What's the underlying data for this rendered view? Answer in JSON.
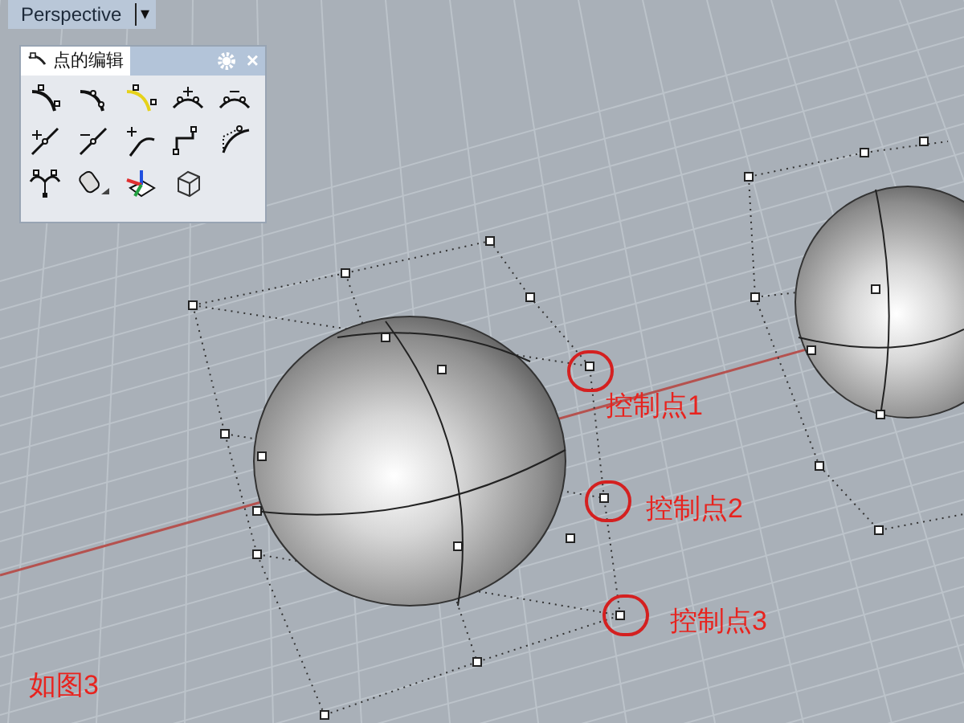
{
  "viewport": {
    "title": "Perspective",
    "menu_glyph": "▾"
  },
  "toolbar": {
    "title": "点的编辑",
    "close_glyph": "×"
  },
  "annotations": [
    {
      "label": "控制点1"
    },
    {
      "label": "控制点2"
    },
    {
      "label": "控制点3"
    }
  ],
  "caption": "如图3"
}
